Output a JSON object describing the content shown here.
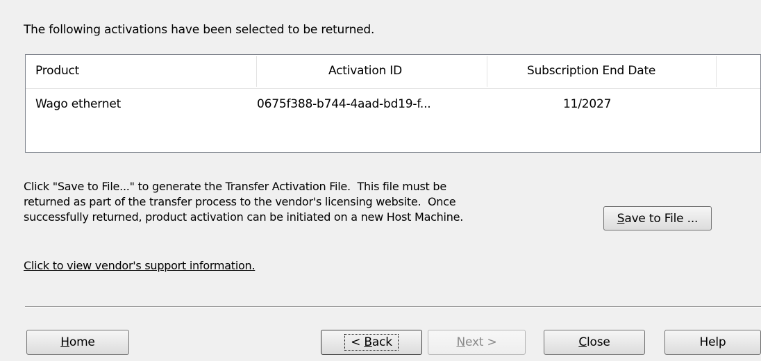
{
  "intro_text": "The following activations have been selected to be returned.",
  "table": {
    "columns": [
      "Product",
      "Activation ID",
      "Subscription End Date"
    ],
    "rows": [
      [
        "Wago ethernet",
        "0675f388-b744-4aad-bd19-f...",
        "11/2027"
      ]
    ]
  },
  "info_lines": [
    "Click \"Save to File...\" to generate the Transfer Activation File.  This file must be",
    "returned as part of the transfer process to the vendor's licensing website.  Once",
    "successfully returned, product activation can be initiated on a new Host Machine."
  ],
  "save_button": {
    "mnemonic": "S",
    "rest": "ave to File ..."
  },
  "support_link": "Click to view vendor's support information.",
  "buttons": {
    "home": {
      "mnemonic": "H",
      "rest": "ome"
    },
    "back": {
      "prefix": "< ",
      "mnemonic": "B",
      "rest": "ack"
    },
    "next": {
      "mnemonic": "N",
      "rest": "ext >"
    },
    "close": {
      "mnemonic": "C",
      "rest": "lose"
    },
    "help": {
      "label": "Help"
    }
  }
}
